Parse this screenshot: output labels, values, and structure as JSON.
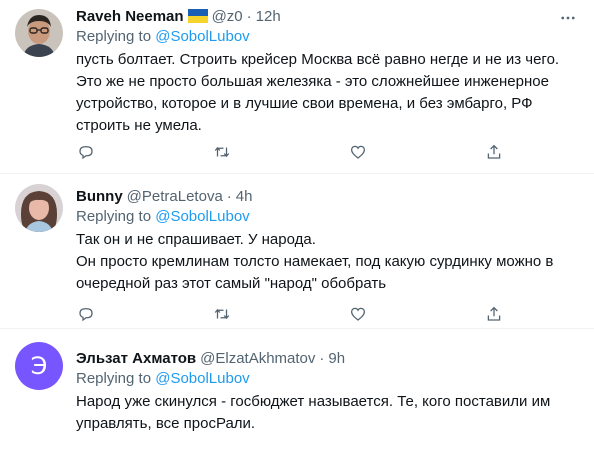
{
  "tweets": [
    {
      "name": "Raveh Neeman",
      "has_flag": true,
      "handle": "@z0",
      "dot": "·",
      "time": "12h",
      "replying_prefix": "Replying to ",
      "replying_to": "@SobolLubov",
      "text": "пусть болтает. Строить крейсер Москва всё равно негде и не из чего. Это же не просто большая железяка - это сложнейшее инженерное устройство, которое и в лучшие свои времена, и без эмбарго, РФ строить не умела."
    },
    {
      "name": "Bunny",
      "handle": "@PetraLetova",
      "dot": "·",
      "time": "4h",
      "replying_prefix": "Replying to ",
      "replying_to": "@SobolLubov",
      "text": "Так он и не спрашивает. У народа.\nОн просто кремлинам толсто намекает, под какую сурдинку можно в очередной раз этот самый \"народ\" обобрать"
    },
    {
      "name": "Эльзат Ахматов",
      "handle": "@ElzatAkhmatov",
      "dot": "·",
      "time": "9h",
      "avatar_letter": "Э",
      "replying_prefix": "Replying to ",
      "replying_to": "@SobolLubov",
      "text": "Народ уже скинулся - госбюджет называется. Те, кого поставили им управлять, все просРали."
    }
  ],
  "colors": {
    "accent": "#1d9bf0",
    "secondary_text": "#536471",
    "avatar_letter_bg": "#7856ff"
  },
  "icons": [
    "more-icon",
    "reply-icon",
    "retweet-icon",
    "like-icon",
    "share-icon"
  ]
}
